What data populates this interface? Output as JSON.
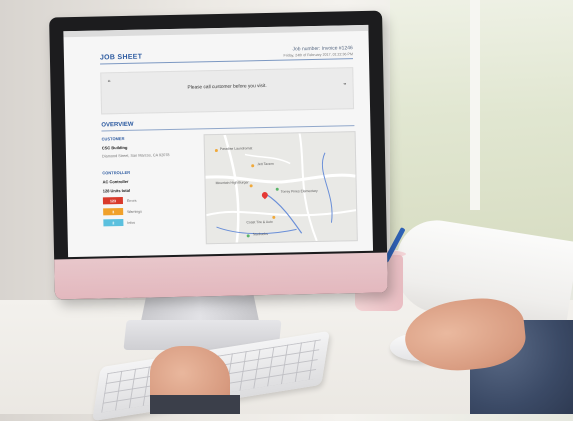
{
  "job_sheet": {
    "title": "JOB SHEET",
    "job_number": "Job number: Invoice #1246",
    "date_line": "Friday, 24th of February 2017, 01:22:36 PM"
  },
  "notes": {
    "text": "Please call customer before you visit."
  },
  "overview": {
    "heading": "OVERVIEW",
    "customer": {
      "label": "CUSTOMER",
      "name": "CSC Building",
      "address": "Diamond Street, San Marcos, CA 92078"
    },
    "controller": {
      "label": "CONTROLLER",
      "name": "AC Controller",
      "units": "128 Units total",
      "badges": [
        {
          "value": "123",
          "label": "Errors",
          "color": "#d93a2b"
        },
        {
          "value": "3",
          "label": "Warnings",
          "color": "#f0a12b"
        },
        {
          "value": "2",
          "label": "Infos",
          "color": "#5bc0de"
        }
      ]
    },
    "map": {
      "labels": [
        "Paradise Laundromat",
        "Jett Tavern",
        "Mountain High Burger",
        "Torrey Pines Elementary",
        "Coast Tire & Auto",
        "Starbucks"
      ]
    }
  },
  "colors": {
    "accent": "#2c5aa0"
  }
}
